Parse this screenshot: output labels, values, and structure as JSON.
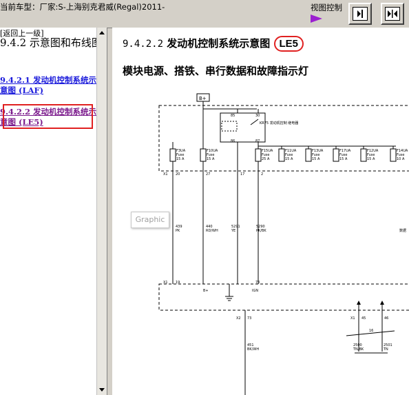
{
  "window": {
    "car_title": "当前车型：厂家:S-上海别克君威(Regal)2011-",
    "view_control": "视图控制",
    "buttons": [
      {
        "name": "expand-pane-button",
        "icon": "arrow-right-into-bar-icon"
      },
      {
        "name": "collapse-pane-button",
        "icon": "arrows-inward-icon"
      }
    ]
  },
  "sidebar": {
    "back_link": "[返回上一级]",
    "heading": "9.4.2 示意图和布线图",
    "items": [
      {
        "label": "9.4.2.1 发动机控制系统示意图 (LAF)",
        "active": false
      },
      {
        "label": "9.4.2.2 发动机控制系统示意图 (LE5)",
        "active": true
      }
    ]
  },
  "content": {
    "section_number": "9.4.2.2",
    "section_title": "发动机控制系统示意图",
    "engine_code": "LE5",
    "subheading": "模块电源、搭铁、串行数据和故障指示灯",
    "tooltip": "Graphic"
  },
  "diagram": {
    "battery_label": "B+",
    "relay": {
      "pins": [
        "85",
        "30",
        "86",
        "87"
      ],
      "label": "KR75 发动机控制 继电器"
    },
    "fuses_left": [
      {
        "name": "F3UA",
        "lines": [
          "Fuse",
          "15 A"
        ]
      },
      {
        "name": "F10UA",
        "lines": [
          "Fuse",
          "15 A"
        ]
      }
    ],
    "fuses_right": [
      {
        "name": "F15UA",
        "lines": [
          "Fuse",
          "25 A"
        ]
      },
      {
        "name": "F11UA",
        "lines": [
          "Fuse",
          "15 A"
        ]
      },
      {
        "name": "F13UA",
        "lines": [
          "Fuse",
          "15 A"
        ]
      },
      {
        "name": "F17UA",
        "lines": [
          "Fuse",
          "15 A"
        ]
      },
      {
        "name": "F12UA",
        "lines": [
          "Fuse",
          "15 A"
        ]
      },
      {
        "name": "F14UA",
        "lines": [
          "Fuse",
          "10 A"
        ]
      }
    ],
    "connector_x1_top": [
      "X1",
      "20",
      "27",
      "17",
      "2"
    ],
    "wires": [
      {
        "lines": [
          "439",
          "PK"
        ]
      },
      {
        "lines": [
          "440",
          "RD/WH"
        ]
      },
      {
        "lines": [
          "5291",
          "YE"
        ]
      },
      {
        "lines": [
          "5290",
          "PK/BK"
        ]
      }
    ],
    "ecm_pins": [
      "X1",
      "19",
      "B+",
      "73",
      "IGN"
    ],
    "x2_pin": [
      "X2",
      "73"
    ],
    "bottom_wire": {
      "lines": [
        "451",
        "BK/WH"
      ]
    },
    "x1_right": [
      "X1",
      "45",
      "46"
    ],
    "right_pin": "16",
    "can_wires": [
      {
        "lines": [
          "2500",
          "TN/BK"
        ]
      },
      {
        "lines": [
          "2501",
          "TN"
        ]
      }
    ],
    "edge_label": "数据"
  }
}
